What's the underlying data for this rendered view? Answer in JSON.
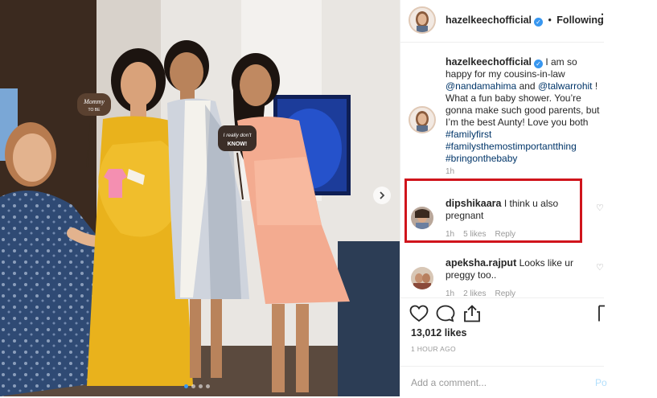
{
  "post": {
    "username": "hazelkeechofficial",
    "following_label": "Following",
    "caption": {
      "text_1": "I am so happy for my cousins-in-law",
      "mention_1": "@nandamahima",
      "and": "and",
      "mention_2": "@talwarrohit",
      "text_2": "! What a fun baby shower. You’re gonna make such good parents, but I’m the best Aunty! Love you both",
      "hashtags": [
        "#familyfirst",
        "#familysthemostimportantthing",
        "#bringonthebaby"
      ],
      "time": "1h"
    },
    "comments": [
      {
        "username": "dipshikaara",
        "text": "I think u also pregnant",
        "time": "1h",
        "likes": "5 likes",
        "reply": "Reply"
      },
      {
        "username": "apeksha.rajput",
        "text": "Looks like ur preggy too..",
        "time": "1h",
        "likes": "2 likes",
        "reply": "Reply"
      }
    ],
    "likes": "13,012 likes",
    "posted": "1 HOUR AGO",
    "add_comment_placeholder": "Add a comment...",
    "post_label": "Po",
    "photo": {
      "sign_left": "Mommy\nTO BE",
      "sign_right": "I really don't\nKNOW!",
      "carousel_active_index": 0
    }
  },
  "icons": {
    "verified": "verified-badge-icon",
    "more": "more-options-icon",
    "heart": "heart-icon",
    "comment": "comment-icon",
    "share": "share-icon",
    "save": "bookmark-icon",
    "next": "chevron-right-icon"
  },
  "colors": {
    "link": "#003569",
    "verified": "#3897f0",
    "highlight_box": "#d0141c",
    "meta_gray": "#999999"
  }
}
